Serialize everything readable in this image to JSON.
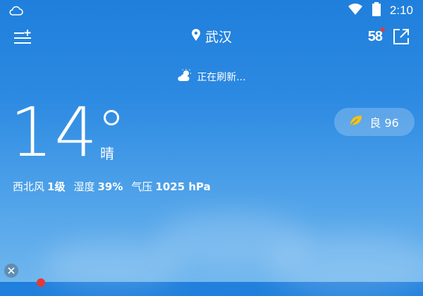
{
  "status_bar": {
    "time": "2:10"
  },
  "header": {
    "city": "武汉",
    "aqi_short": "58"
  },
  "refresh": {
    "text": "正在刷新..."
  },
  "current": {
    "temperature": "14",
    "condition": "晴",
    "wind_label": "西北风",
    "wind_value": "1级",
    "humidity_label": "湿度",
    "humidity_value": "39%",
    "pressure_label": "气压",
    "pressure_value": "1025 hPa"
  },
  "aqi_badge": {
    "label": "良 96"
  },
  "icons": {
    "status_left": "cloud-notification-icon",
    "wifi": "wifi-icon",
    "battery": "battery-icon",
    "menu": "menu-add-icon",
    "location": "location-pin-icon",
    "share": "share-icon",
    "refresh": "partly-sunny-icon",
    "leaf": "leaf-icon",
    "close": "close-icon"
  },
  "colors": {
    "sky_top": "#1f7fdc",
    "sky_bottom": "#6fb6ee",
    "leaf": "#f2c21a",
    "dot": "#e53935"
  }
}
